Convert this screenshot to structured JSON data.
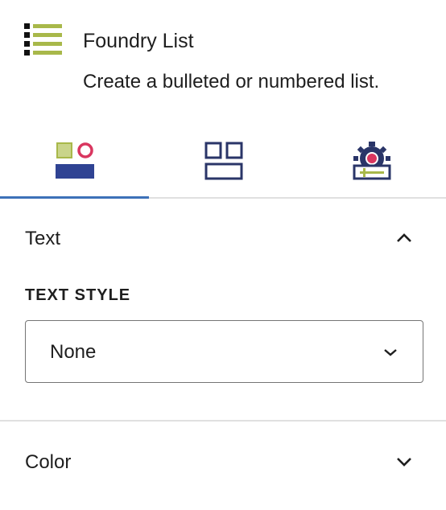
{
  "block": {
    "title": "Foundry List",
    "description": "Create a bulleted or numbered list.",
    "icon": "list-icon"
  },
  "tabs": [
    {
      "name": "styles",
      "icon": "style-shapes-icon",
      "active": true
    },
    {
      "name": "layout",
      "icon": "layout-grid-icon",
      "active": false
    },
    {
      "name": "advanced",
      "icon": "settings-gear-icon",
      "active": false
    }
  ],
  "panels": {
    "text": {
      "title": "Text",
      "expanded": true,
      "text_style_label": "TEXT STYLE",
      "text_style_value": "None"
    },
    "color": {
      "title": "Color",
      "expanded": false
    }
  },
  "colors": {
    "accent": "#3d71b8",
    "navy": "#2a3568",
    "olive": "#a8b84a",
    "pink": "#d9365f",
    "border": "#e0e0e0"
  }
}
